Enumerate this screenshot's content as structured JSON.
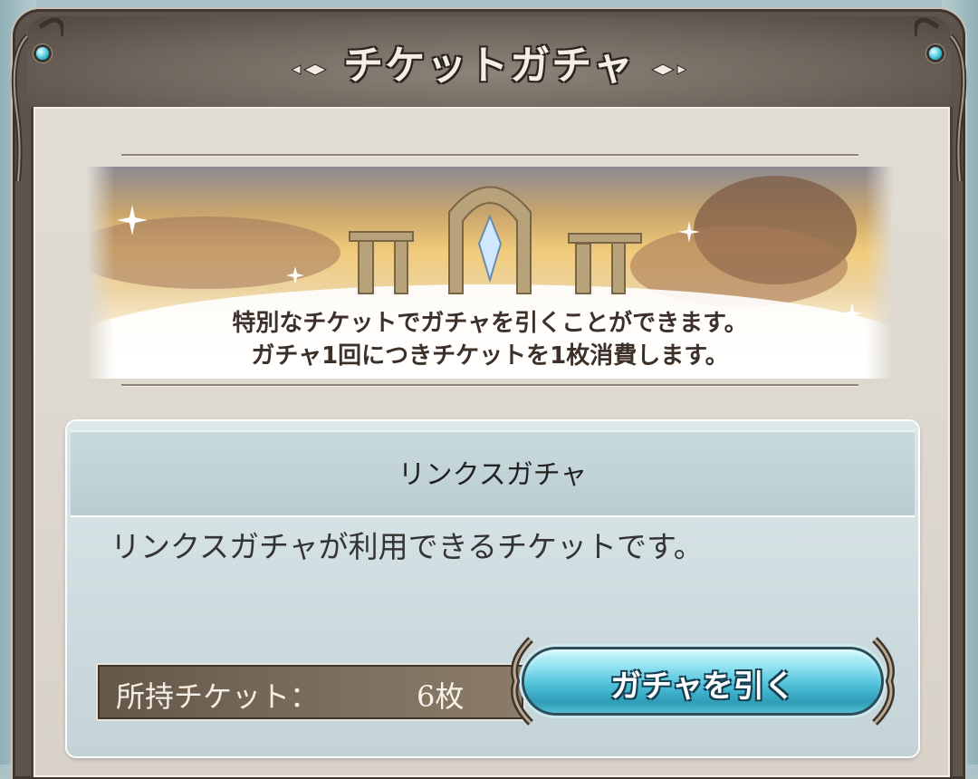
{
  "window": {
    "title": "チケットガチャ"
  },
  "banner": {
    "line1": "特別なチケットでガチャを引くことができます。",
    "line2": "ガチャ1回につきチケットを1枚消費します。"
  },
  "ticket": {
    "name": "リンクスガチャ",
    "description": "リンクスガチャが利用できるチケットです。",
    "owned_label": "所持チケット：",
    "owned_count": "6枚",
    "draw_label": "ガチャを引く"
  },
  "colors": {
    "accent": "#4fc2da",
    "frame": "#5f544b",
    "gem": "#36c3d9"
  }
}
